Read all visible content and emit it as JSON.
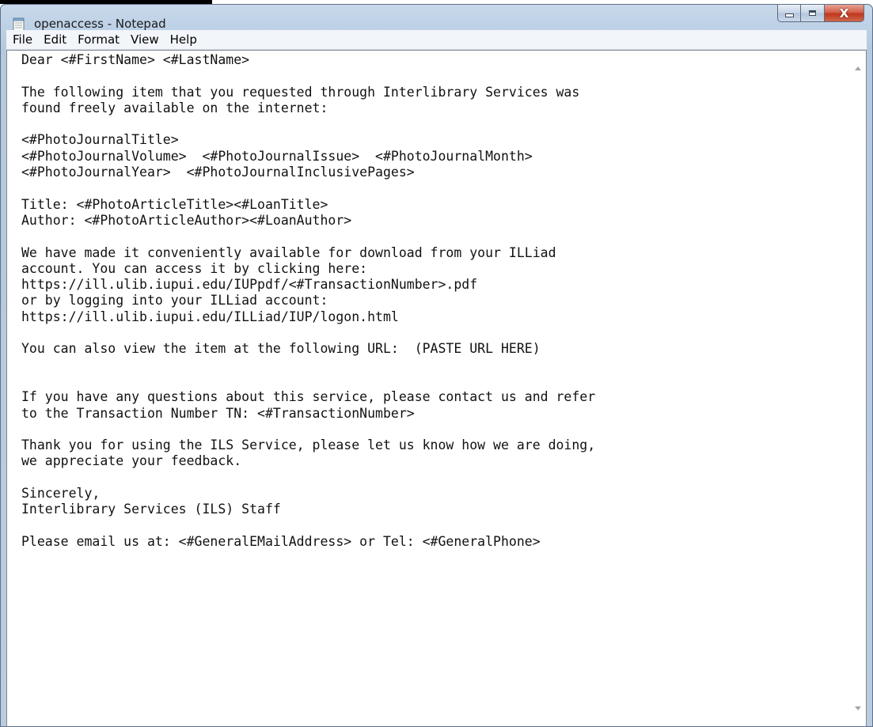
{
  "window": {
    "title": "openaccess - Notepad",
    "app_icon": "notepad-icon"
  },
  "controls": {
    "minimize_icon": "minimize-icon",
    "maximize_icon": "maximize-icon",
    "close_glyph": "X"
  },
  "menu": {
    "items": [
      "File",
      "Edit",
      "Format",
      "View",
      "Help"
    ]
  },
  "document": {
    "lines": [
      "Dear <#FirstName> <#LastName>",
      "",
      "The following item that you requested through Interlibrary Services was",
      "found freely available on the internet:",
      "",
      "<#PhotoJournalTitle>",
      "<#PhotoJournalVolume>  <#PhotoJournalIssue>  <#PhotoJournalMonth>",
      "<#PhotoJournalYear>  <#PhotoJournalInclusivePages>",
      "",
      "Title: <#PhotoArticleTitle><#LoanTitle>",
      "Author: <#PhotoArticleAuthor><#LoanAuthor>",
      "",
      "We have made it conveniently available for download from your ILLiad",
      "account. You can access it by clicking here:",
      "https://ill.ulib.iupui.edu/IUPpdf/<#TransactionNumber>.pdf",
      "or by logging into your ILLiad account:",
      "https://ill.ulib.iupui.edu/ILLiad/IUP/logon.html",
      "",
      "You can also view the item at the following URL:  (PASTE URL HERE)",
      "",
      "",
      "If you have any questions about this service, please contact us and refer",
      "to the Transaction Number TN: <#TransactionNumber>",
      "",
      "Thank you for using the ILS Service, please let us know how we are doing,",
      "we appreciate your feedback.",
      "",
      "Sincerely,",
      "Interlibrary Services (ILS) Staff",
      "",
      "Please email us at: <#GeneralEMailAddress> or Tel: <#GeneralPhone>"
    ]
  }
}
